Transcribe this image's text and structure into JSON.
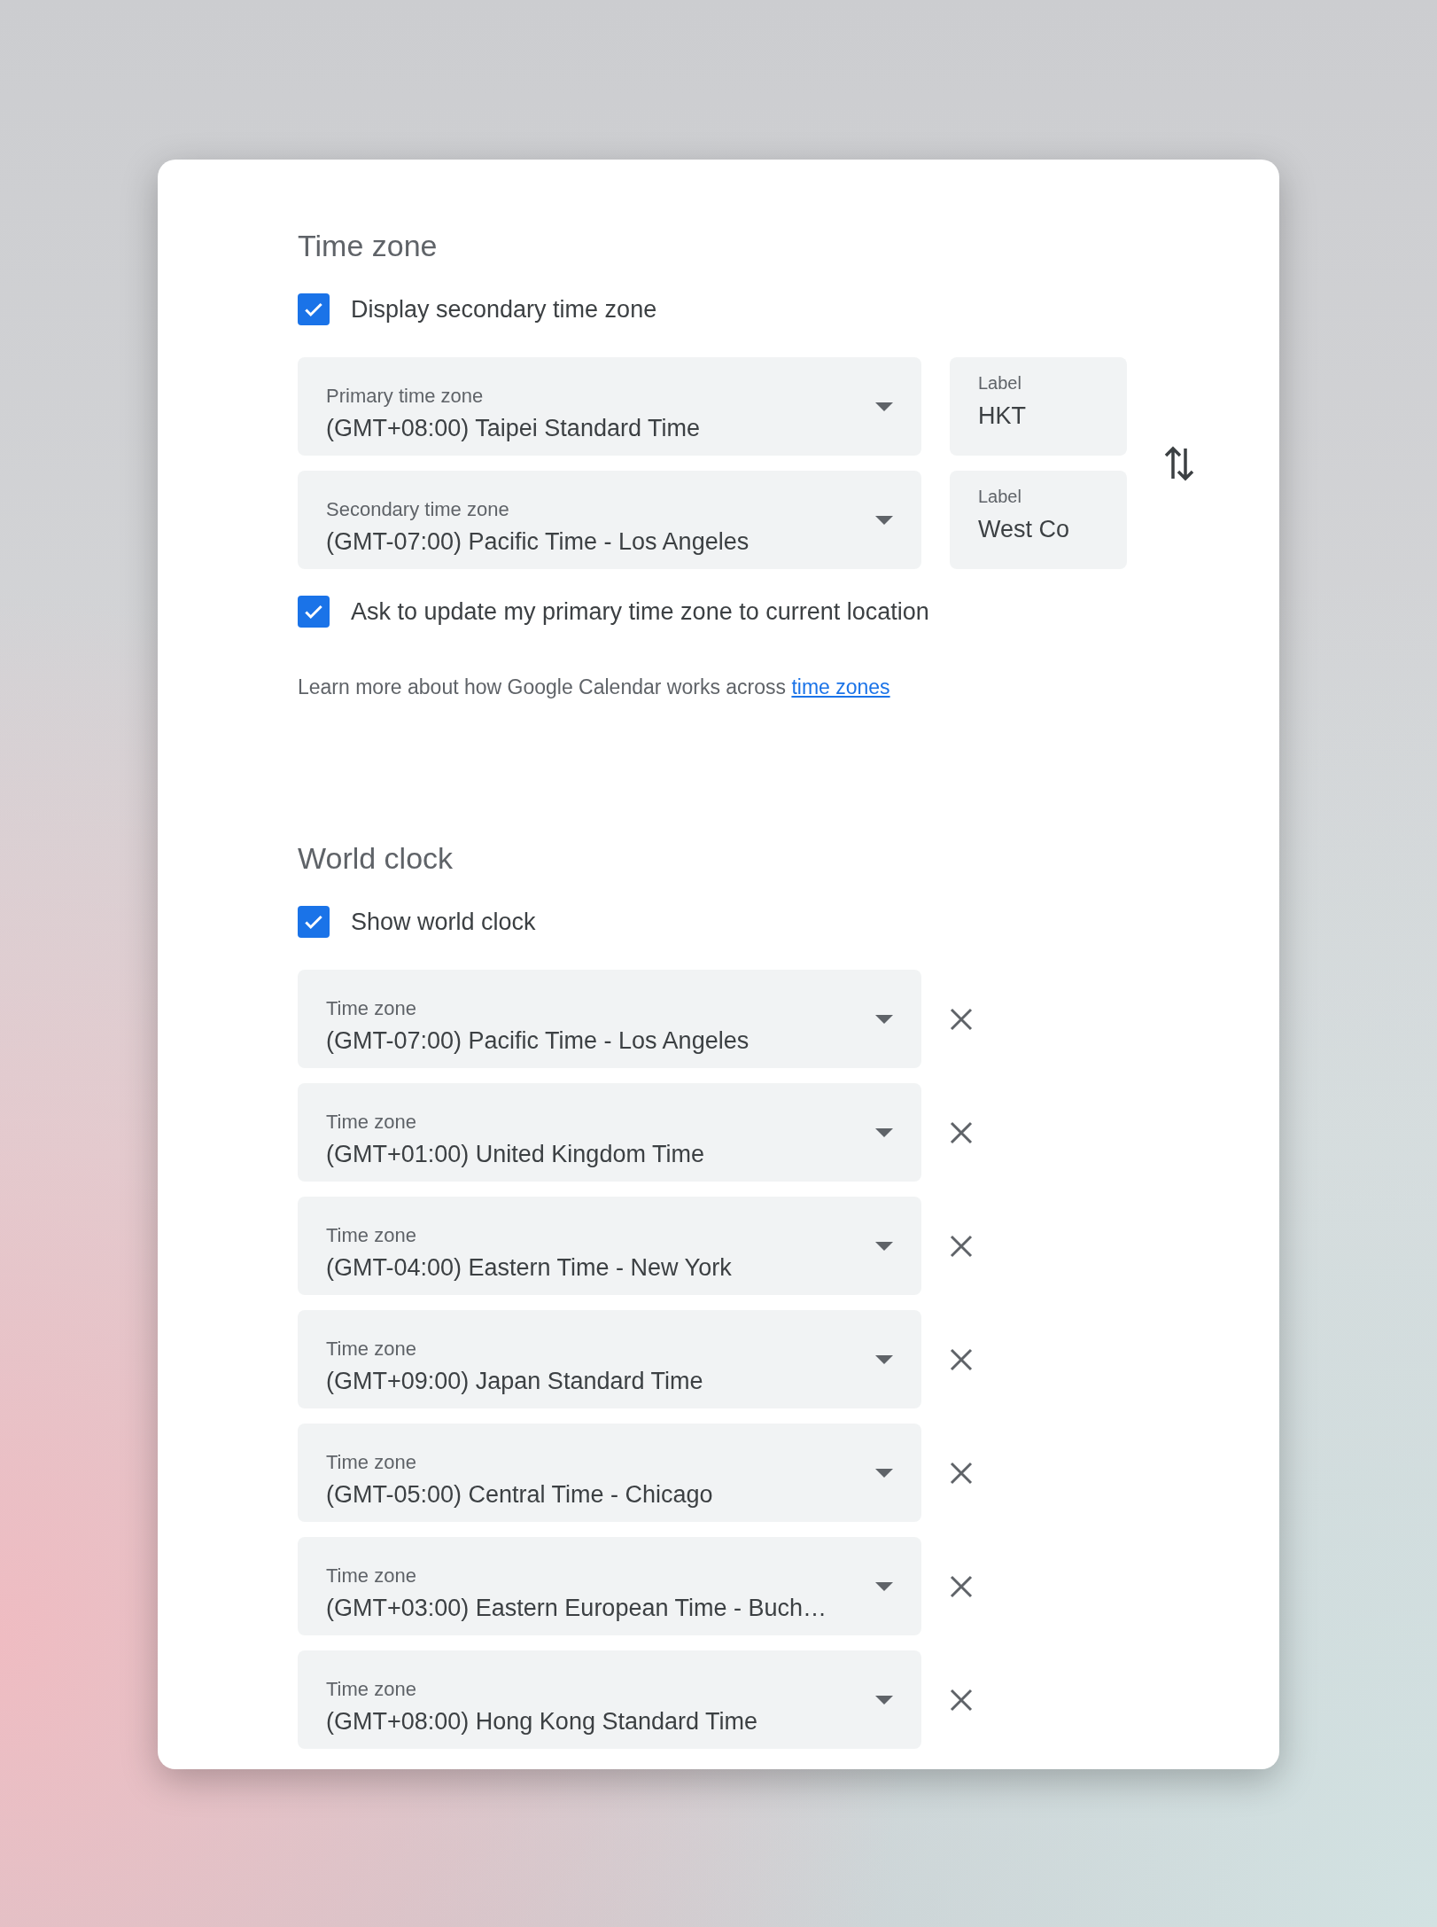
{
  "time_zone": {
    "title": "Time zone",
    "display_secondary": {
      "label": "Display secondary time zone",
      "checked": true
    },
    "zones": [
      {
        "caption": "Primary time zone",
        "value": "(GMT+08:00) Taipei Standard Time",
        "label_caption": "Label",
        "label_value": "HKT"
      },
      {
        "caption": "Secondary time zone",
        "value": "(GMT-07:00) Pacific Time - Los Angeles",
        "label_caption": "Label",
        "label_value": "West Co"
      }
    ],
    "ask_update": {
      "label": "Ask to update my primary time zone to current location",
      "checked": true
    },
    "help": {
      "text": "Learn more about how Google Calendar works across",
      "link": "time zones"
    }
  },
  "world_clock": {
    "title": "World clock",
    "show": {
      "label": "Show world clock",
      "checked": true
    },
    "zones": [
      {
        "caption": "Time zone",
        "value": "(GMT-07:00) Pacific Time - Los Angeles"
      },
      {
        "caption": "Time zone",
        "value": "(GMT+01:00) United Kingdom Time"
      },
      {
        "caption": "Time zone",
        "value": "(GMT-04:00) Eastern Time - New York"
      },
      {
        "caption": "Time zone",
        "value": "(GMT+09:00) Japan Standard Time"
      },
      {
        "caption": "Time zone",
        "value": "(GMT-05:00) Central Time - Chicago"
      },
      {
        "caption": "Time zone",
        "value": "(GMT+03:00) Eastern European Time - Buch…"
      },
      {
        "caption": "Time zone",
        "value": "(GMT+08:00) Hong Kong Standard Time"
      }
    ]
  }
}
